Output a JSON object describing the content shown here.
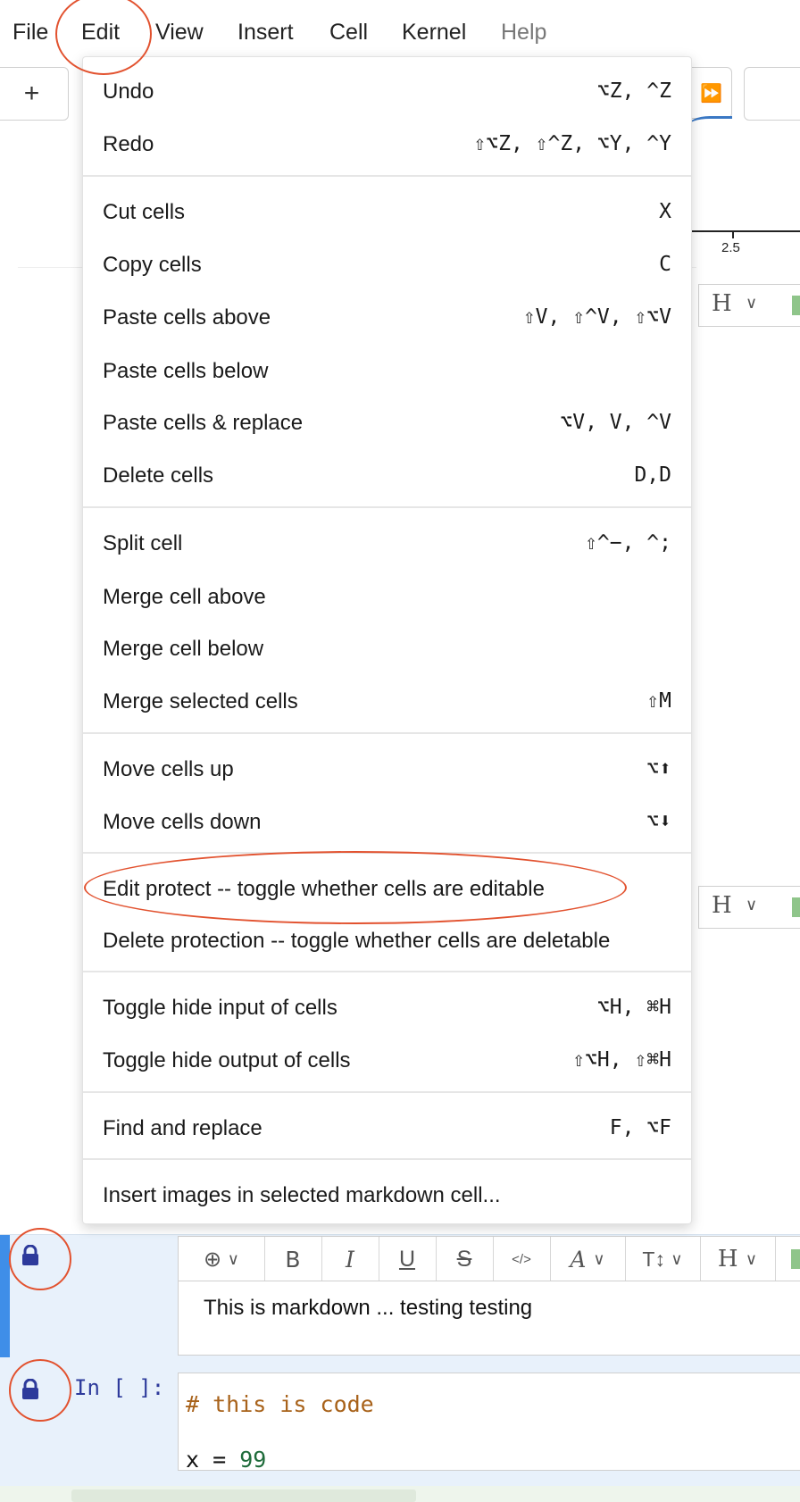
{
  "menubar": {
    "items": [
      "File",
      "Edit",
      "View",
      "Insert",
      "Cell",
      "Kernel",
      "Help"
    ]
  },
  "toolbar": {
    "add_label": "+",
    "run_all_label": "⏩"
  },
  "background": {
    "chart_tick_label": "2.5"
  },
  "edit_menu": {
    "items": [
      {
        "label": "Undo",
        "shortcut": "⌥Z, ^Z"
      },
      {
        "label": "Redo",
        "shortcut": "⇧⌥Z, ⇧^Z, ⌥Y, ^Y"
      },
      {
        "label": "Cut cells",
        "shortcut": "X"
      },
      {
        "label": "Copy cells",
        "shortcut": "C"
      },
      {
        "label": "Paste cells above",
        "shortcut": "⇧V, ⇧^V, ⇧⌥V"
      },
      {
        "label": "Paste cells below",
        "shortcut": ""
      },
      {
        "label": "Paste cells & replace",
        "shortcut": "⌥V, V, ^V"
      },
      {
        "label": "Delete cells",
        "shortcut": "D,D"
      },
      {
        "label": "Split cell",
        "shortcut": "⇧^−, ^;"
      },
      {
        "label": "Merge cell above",
        "shortcut": ""
      },
      {
        "label": "Merge cell below",
        "shortcut": ""
      },
      {
        "label": "Merge selected cells",
        "shortcut": "⇧M"
      },
      {
        "label": "Move cells up",
        "shortcut": "⌥⬆"
      },
      {
        "label": "Move cells down",
        "shortcut": "⌥⬇"
      },
      {
        "label": "Edit protect -- toggle whether cells are editable",
        "shortcut": ""
      },
      {
        "label": "Delete protection -- toggle whether cells are deletable",
        "shortcut": ""
      },
      {
        "label": "Toggle hide input of cells",
        "shortcut": "⌥H, ⌘H"
      },
      {
        "label": "Toggle hide output of cells",
        "shortcut": "⇧⌥H, ⇧⌘H"
      },
      {
        "label": "Find and replace",
        "shortcut": "F, ⌥F"
      },
      {
        "label": "Insert images in selected markdown cell...",
        "shortcut": ""
      }
    ]
  },
  "markdown_toolbar": {
    "insert": "⊕",
    "bold": "B",
    "italic": "I",
    "underline": "U",
    "strike": "S",
    "code": "</>",
    "font": "A",
    "size": "T↕",
    "heading": "H"
  },
  "markdown_cell": {
    "text": "This is markdown ... testing testing"
  },
  "code_cell": {
    "prompt": "In [ ]:",
    "line1": "# this is code",
    "line2_prefix": "x = ",
    "line2_number": "99"
  },
  "colors": {
    "annotation": "#e2522f",
    "prompt": "#2d3a9b",
    "selection_bar": "#3f8ee8",
    "cell_bg": "#e8f1fb"
  }
}
